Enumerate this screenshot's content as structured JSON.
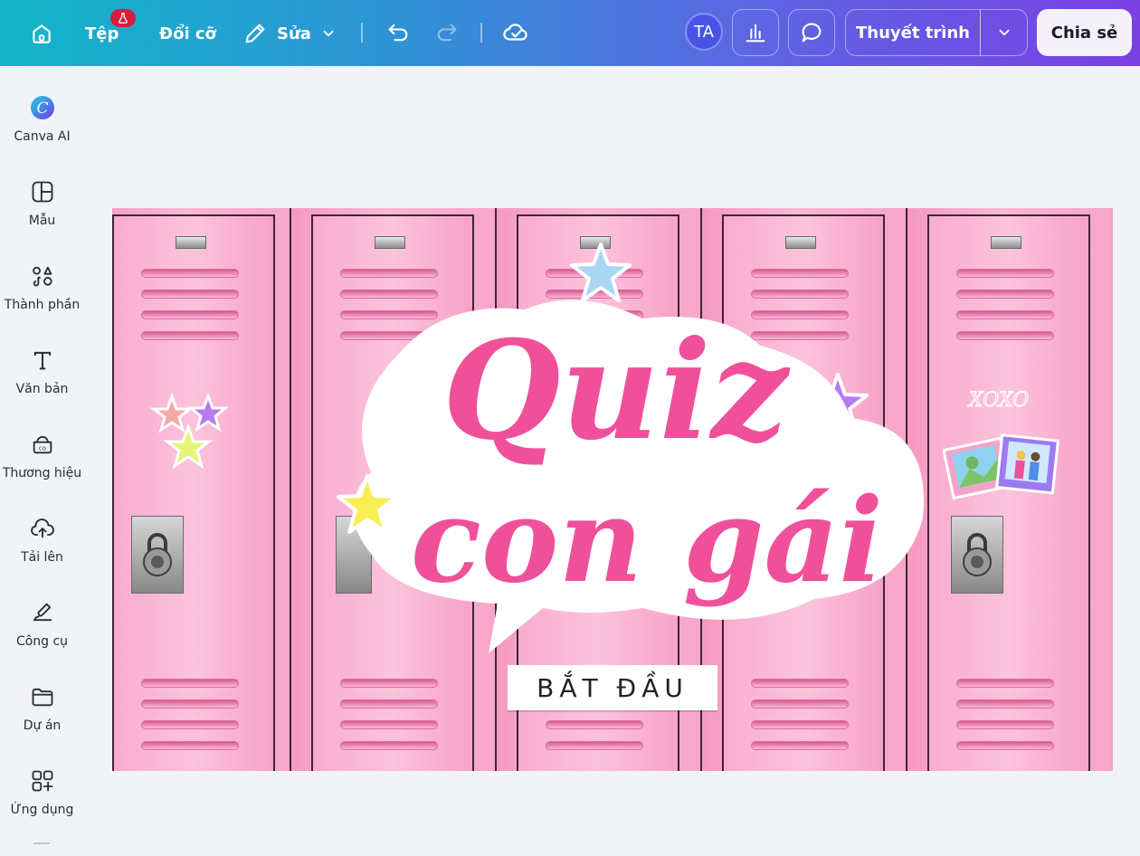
{
  "topbar": {
    "file_label": "Tệp",
    "resize_label": "Đổi cỡ",
    "edit_label": "Sửa",
    "avatar_initials": "TA",
    "present_label": "Thuyết trình",
    "share_label": "Chia sẻ"
  },
  "sidebar": {
    "items": [
      {
        "label": "Canva AI",
        "icon": "canva-ai-icon"
      },
      {
        "label": "Mẫu",
        "icon": "template-icon"
      },
      {
        "label": "Thành phần",
        "icon": "elements-icon"
      },
      {
        "label": "Văn bản",
        "icon": "text-icon"
      },
      {
        "label": "Thương hiệu",
        "icon": "brand-icon"
      },
      {
        "label": "Tải lên",
        "icon": "upload-icon"
      },
      {
        "label": "Công cụ",
        "icon": "tools-icon"
      },
      {
        "label": "Dự án",
        "icon": "folder-icon"
      },
      {
        "label": "Ứng dụng",
        "icon": "apps-icon"
      }
    ]
  },
  "canvas": {
    "title_line1": "Quiz",
    "title_line2": "con gái",
    "sticker_text": "XOXO",
    "start_button_label": "BẮT ĐẦU"
  },
  "colors": {
    "gradient_start": "#12b5c8",
    "gradient_end": "#7b3fe4",
    "title_pink": "#f0509a",
    "locker_pink": "#f9acce"
  }
}
